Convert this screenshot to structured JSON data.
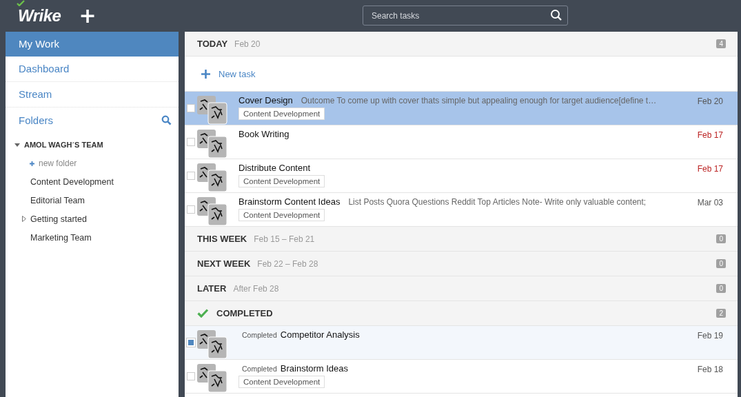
{
  "header": {
    "logo": "Wrike",
    "add_button": "+",
    "search": {
      "placeholder": "Search tasks"
    }
  },
  "sidebar": {
    "nav": [
      {
        "label": "My Work",
        "selected": true
      },
      {
        "label": "Dashboard",
        "selected": false
      },
      {
        "label": "Stream",
        "selected": false
      }
    ],
    "folders_label": "Folders",
    "team": {
      "name": "AMOL WAGH´S TEAM",
      "expanded": true
    },
    "new_folder": "new folder",
    "folders": [
      {
        "label": "Content Development",
        "has_children": false
      },
      {
        "label": "Editorial Team",
        "has_children": false
      },
      {
        "label": "Getting started",
        "has_children": true
      },
      {
        "label": "Marketing Team",
        "has_children": false
      }
    ]
  },
  "sections": [
    {
      "kind": "group",
      "title": "TODAY",
      "range": "Feb 20",
      "count": "4",
      "new_task": "New task",
      "tasks": [
        {
          "title": "Cover Design",
          "description": "Outcome To come up with cover thats simple but appealing enough for target audience[define t…",
          "tag": "Content Development",
          "date": "Feb 20",
          "selected": true,
          "checked": false,
          "overdue": false
        },
        {
          "title": "Book Writing",
          "date": "Feb 17",
          "selected": false,
          "checked": false,
          "overdue": true
        },
        {
          "title": "Distribute Content",
          "tag": "Content Development",
          "date": "Feb 17",
          "selected": false,
          "checked": false,
          "overdue": true
        },
        {
          "title": "Brainstorm Content Ideas",
          "description": "List Posts Quora Questions Reddit Top Articles Note- Write only valuable content;",
          "tag": "Content Development",
          "date": "Mar 03",
          "selected": false,
          "checked": false,
          "overdue": false
        }
      ]
    },
    {
      "kind": "group",
      "title": "THIS WEEK",
      "range": "Feb 15 – Feb 21",
      "count": "0"
    },
    {
      "kind": "group",
      "title": "NEXT WEEK",
      "range": "Feb 22 – Feb 28",
      "count": "0"
    },
    {
      "kind": "group",
      "title": "LATER",
      "range": "After Feb 28",
      "count": "0"
    },
    {
      "kind": "completed",
      "title": "COMPLETED",
      "count": "2",
      "tasks": [
        {
          "status": "Completed",
          "title": "Competitor Analysis",
          "date": "Feb 19",
          "selected": false,
          "checked": true,
          "overdue": false
        },
        {
          "status": "Completed",
          "title": "Brainstorm Ideas",
          "tag": "Content Development",
          "date": "Feb 18",
          "selected": false,
          "checked": false,
          "overdue": false
        }
      ]
    }
  ]
}
